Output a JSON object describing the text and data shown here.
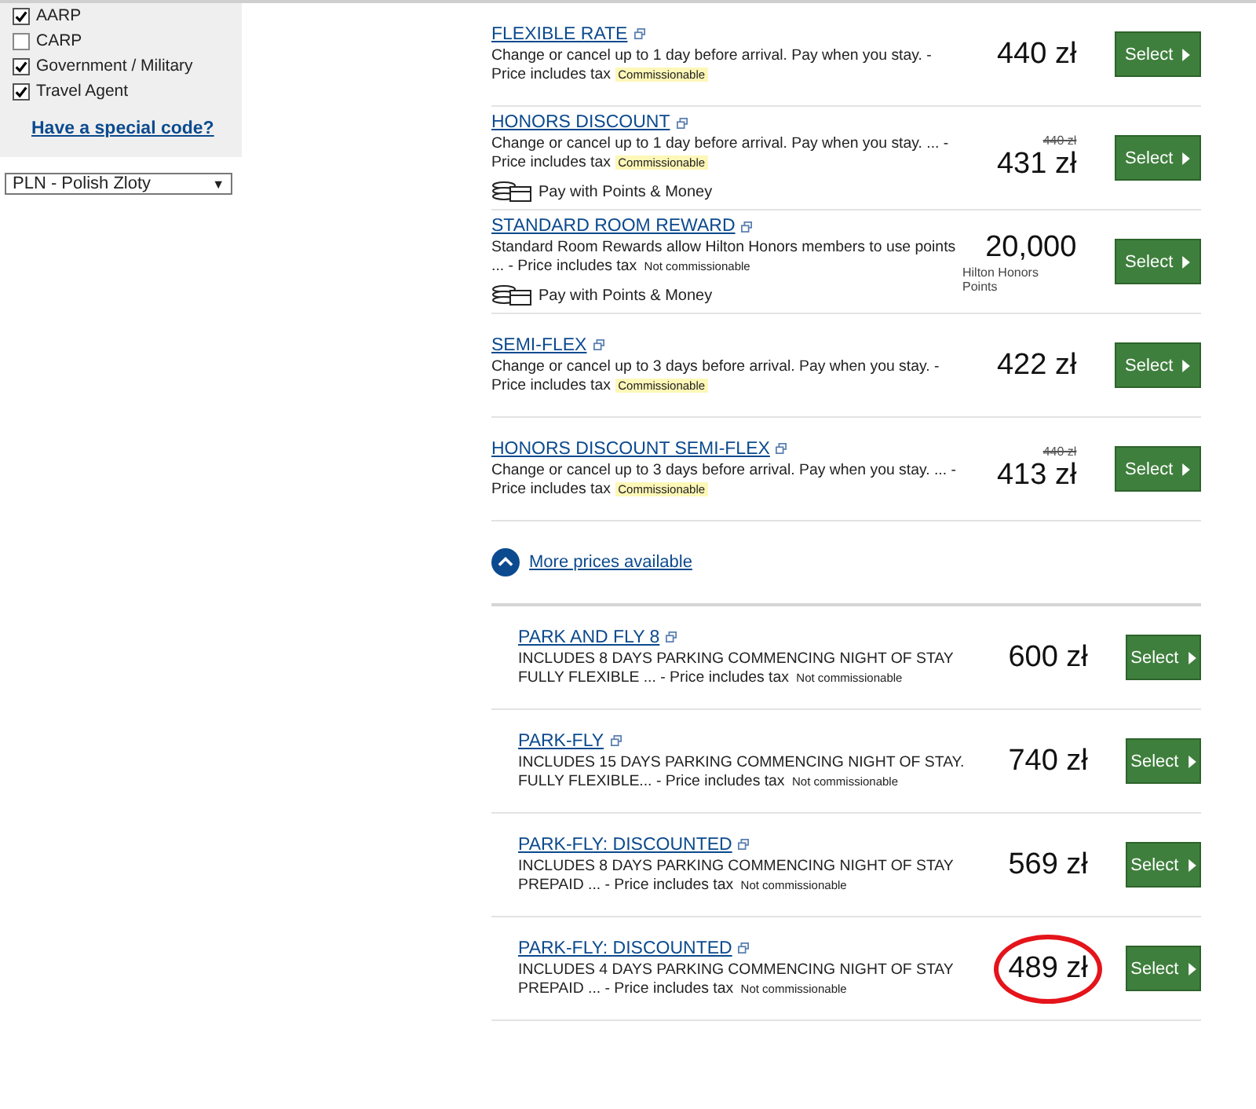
{
  "filters": {
    "options": [
      {
        "label": "AARP",
        "checked": true
      },
      {
        "label": "CARP",
        "checked": false
      },
      {
        "label": "Government / Military",
        "checked": true
      },
      {
        "label": "Travel Agent",
        "checked": true
      }
    ],
    "special_code_link": "Have a special code?"
  },
  "currency_select": {
    "value": "PLN - Polish Zloty",
    "arrow": "▼"
  },
  "rates": [
    {
      "name": "FLEXIBLE RATE",
      "description": "Change or cancel up to 1 day before arrival. Pay when you stay. - Price includes tax",
      "tag": "Commissionable",
      "commissionable": true,
      "price": "440 zł",
      "button": "Select"
    },
    {
      "name": "HONORS DISCOUNT",
      "description": "Change or cancel up to 1 day before arrival. Pay when you stay. ... - Price includes tax",
      "tag": "Commissionable",
      "commissionable": true,
      "old_price": "440 zł",
      "price": "431 zł",
      "pay_option": "Pay with Points & Money",
      "button": "Select"
    },
    {
      "name": "STANDARD ROOM REWARD",
      "description": "Standard Room Rewards allow Hilton Honors members to use points ... - Price includes tax",
      "tag": "Not commissionable",
      "commissionable": false,
      "price": "20,000",
      "price_note": "Hilton Honors Points",
      "pay_option": "Pay with Points & Money",
      "button": "Select"
    },
    {
      "name": "SEMI-FLEX",
      "description": "Change or cancel up to 3 days before arrival. Pay when you stay. - Price includes tax",
      "tag": "Commissionable",
      "commissionable": true,
      "price": "422 zł",
      "button": "Select"
    },
    {
      "name": "HONORS DISCOUNT SEMI-FLEX",
      "description": "Change or cancel up to 3 days before arrival. Pay when you stay. ... - Price includes tax",
      "tag": "Commissionable",
      "commissionable": true,
      "old_price": "440 zł",
      "price": "413 zł",
      "button": "Select"
    }
  ],
  "more_prices": {
    "label": "More prices available",
    "expanded": true
  },
  "more_rates": [
    {
      "name": "PARK AND FLY 8",
      "description": "INCLUDES 8 DAYS PARKING COMMENCING NIGHT OF STAY FULLY FLEXIBLE ... - Price includes tax",
      "tag": "Not commissionable",
      "commissionable": false,
      "price": "600 zł",
      "circled": false,
      "button": "Select"
    },
    {
      "name": "PARK-FLY",
      "description": "INCLUDES 15 DAYS PARKING COMMENCING NIGHT OF STAY. FULLY FLEXIBLE... - Price includes tax",
      "tag": "Not commissionable",
      "commissionable": false,
      "price": "740 zł",
      "circled": false,
      "button": "Select"
    },
    {
      "name": "PARK-FLY: DISCOUNTED",
      "description": "INCLUDES 8 DAYS PARKING COMMENCING NIGHT OF STAY PREPAID ... - Price includes tax",
      "tag": "Not commissionable",
      "commissionable": false,
      "price": "569 zł",
      "circled": false,
      "button": "Select"
    },
    {
      "name": "PARK-FLY: DISCOUNTED",
      "description": "INCLUDES 4 DAYS PARKING COMMENCING NIGHT OF STAY PREPAID ... - Price includes tax",
      "tag": "Not commissionable",
      "commissionable": false,
      "price": "489 zł",
      "circled": true,
      "button": "Select"
    }
  ]
}
